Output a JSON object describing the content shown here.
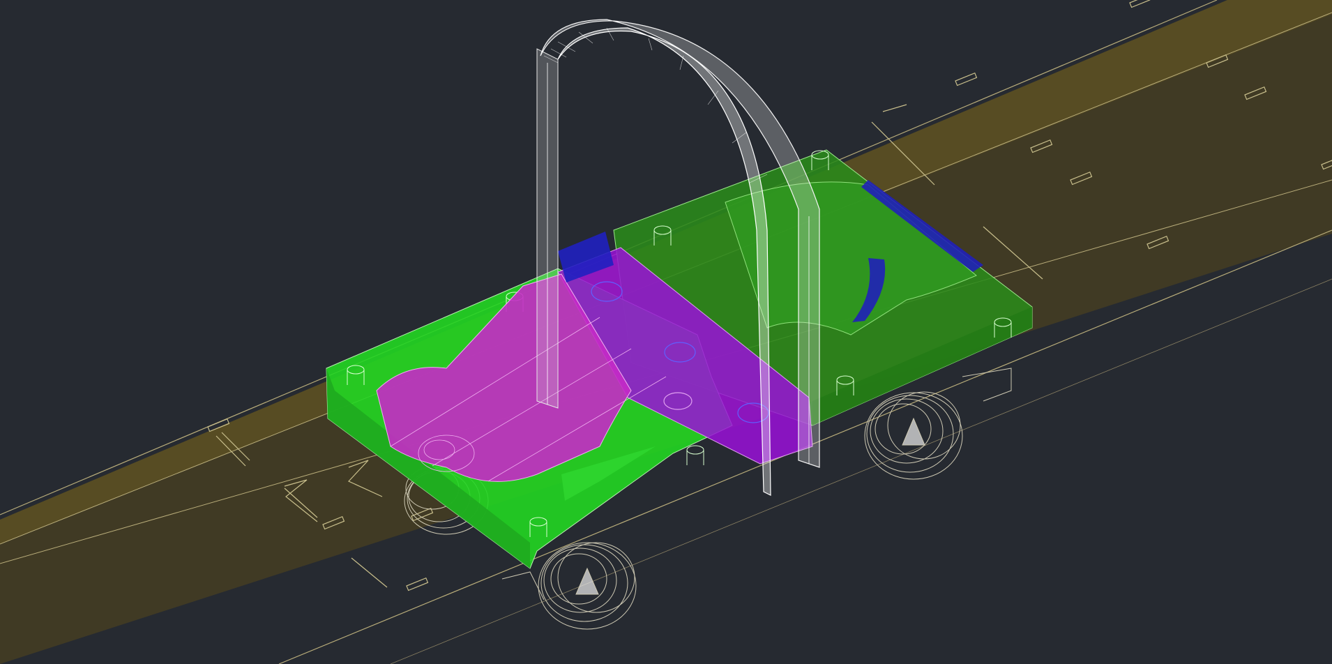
{
  "app": {
    "view_type": "3D isometric model viewport",
    "visual_style": "X-ray wireframe"
  },
  "colors": {
    "background": "#262a31",
    "rail_fill": "#4a4224",
    "rail_edge": "#b9ad7a",
    "base_plate": "#2fd62f",
    "carriage": "#c020d0",
    "handle_frame": "#e8e8e8",
    "blue_parts": "#2020b8",
    "wheel_lines": "#cfcab4"
  },
  "parts": [
    {
      "name": "rail-track",
      "color": "rail_fill"
    },
    {
      "name": "green-base-plate",
      "color": "base_plate"
    },
    {
      "name": "magenta-carriage",
      "color": "carriage"
    },
    {
      "name": "arch-handle",
      "color": "handle_frame"
    },
    {
      "name": "front-left-wheel",
      "color": "wheel_lines"
    },
    {
      "name": "front-right-wheel",
      "color": "wheel_lines"
    },
    {
      "name": "rear-left-wheel",
      "color": "wheel_lines"
    },
    {
      "name": "blue-slot-insert",
      "color": "blue_parts"
    }
  ]
}
